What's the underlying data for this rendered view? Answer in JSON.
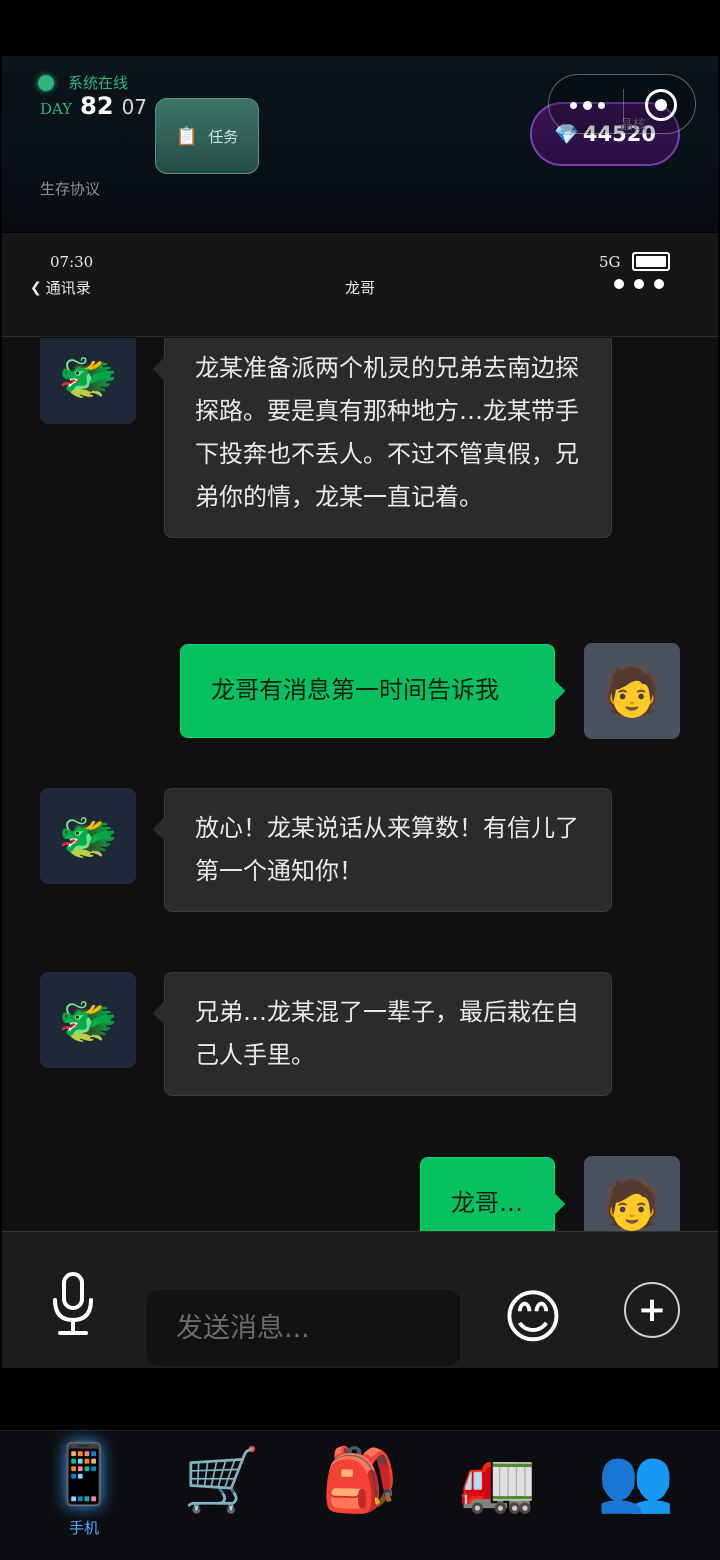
{
  "header": {
    "online_status": "系统在线",
    "day_label": "DAY",
    "day_number": "82",
    "day_extra": "07",
    "task_button": "任务",
    "gems_value": "44520",
    "gems_label": "晶核",
    "protocol_link": "生存协议"
  },
  "phone_status": {
    "time": "07:30",
    "network": "5G",
    "battery_level": 1.0
  },
  "chat": {
    "back_label": "通讯录",
    "title": "龙哥",
    "messages": [
      {
        "sender": "npc",
        "avatar": "🐲",
        "text": "龙某准备派两个机灵的兄弟去南边探探路。要是真有那种地方…龙某带手下投奔也不丢人。不过不管真假，兄弟你的情，龙某一直记着。"
      },
      {
        "sender": "me",
        "avatar": "🧑",
        "text": "龙哥有消息第一时间告诉我"
      },
      {
        "sender": "npc",
        "avatar": "🐲",
        "text": "放心！龙某说话从来算数！有信儿了第一个通知你！"
      },
      {
        "sender": "npc",
        "avatar": "🐲",
        "text": "兄弟…龙某混了一辈子，最后栽在自己人手里。"
      },
      {
        "sender": "me",
        "avatar": "🧑",
        "text": "龙哥…"
      }
    ]
  },
  "input": {
    "placeholder": "发送消息...",
    "emoji": "😊",
    "plus": "+"
  },
  "nav": {
    "items": [
      {
        "icon": "📱",
        "label": "手机",
        "active": true
      },
      {
        "icon": "🛒",
        "label": "",
        "active": false
      },
      {
        "icon": "🎒",
        "label": "",
        "active": false
      },
      {
        "icon": "🚛",
        "label": "",
        "active": false
      },
      {
        "icon": "👥",
        "label": "",
        "active": false
      }
    ]
  },
  "colors": {
    "accent_green": "#07c160",
    "online_green": "#2fb37a",
    "gem_purple": "#7a3eb3",
    "nav_active": "#4fa8ff"
  }
}
